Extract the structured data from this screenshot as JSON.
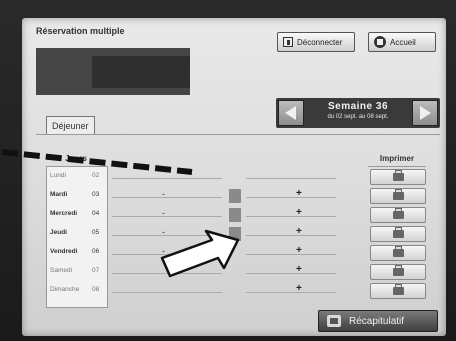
{
  "app": {
    "title": "Réservation multiple"
  },
  "header": {
    "logout_label": "Déconnecter",
    "home_label": "Accueil"
  },
  "week": {
    "label": "Semaine  36",
    "dates": "du 02 sept. au 08 sept."
  },
  "tabs": [
    {
      "label": "Déjeuner"
    }
  ],
  "grid": {
    "col_days": "Jours",
    "col_print": "Imprimer",
    "rows": [
      {
        "day": "Lundi",
        "num": "02"
      },
      {
        "day": "Mardi",
        "num": "03"
      },
      {
        "day": "Mercredi",
        "num": "04"
      },
      {
        "day": "Jeudi",
        "num": "05"
      },
      {
        "day": "Vendredi",
        "num": "06"
      },
      {
        "day": "Samedi",
        "num": "07"
      },
      {
        "day": "Dimanche",
        "num": "08"
      }
    ],
    "minus_symbol": "-",
    "plus_symbol": "+"
  },
  "footer": {
    "recap_label": "Récapitulatif"
  },
  "colors": {
    "screen_bg": "#dcdcdc",
    "accent_dark": "#3a3a3a"
  },
  "icons": [
    "door-icon",
    "home-icon",
    "arrow-left-icon",
    "arrow-right-icon",
    "printer-icon",
    "recap-icon"
  ]
}
